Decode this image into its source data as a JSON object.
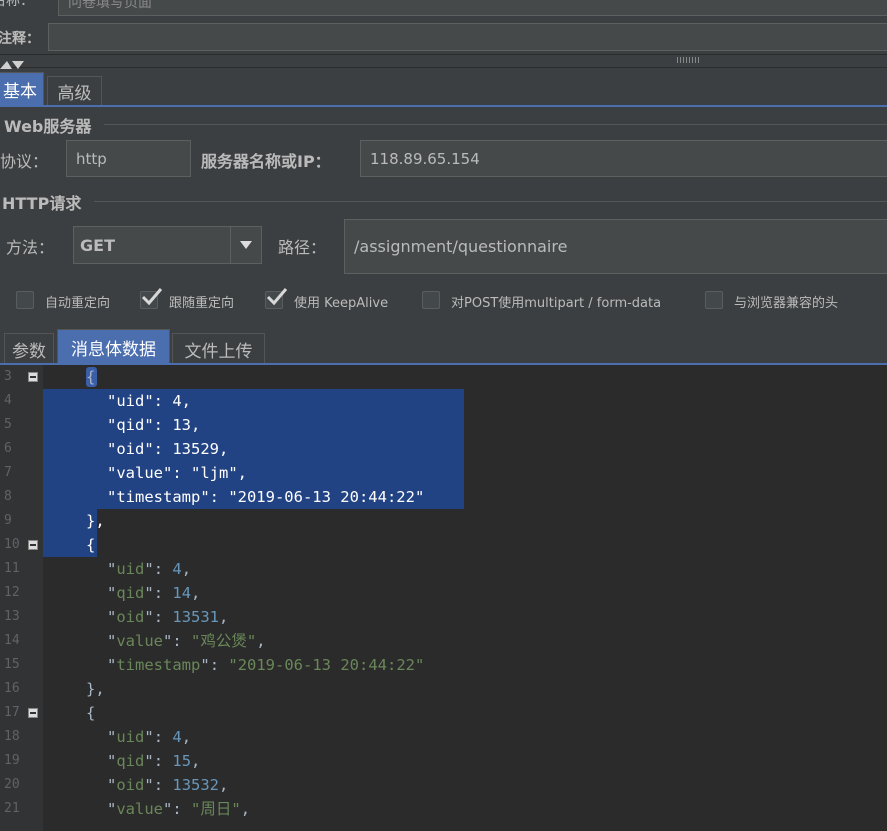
{
  "top": {
    "name_label": "名称：",
    "name_value": "问卷填写页面",
    "comment_label": "注释："
  },
  "config_tabs": [
    "基本",
    "高级"
  ],
  "web_server": {
    "section_title": "Web服务器",
    "protocol_label": "协议：",
    "protocol_value": "http",
    "server_label": "服务器名称或IP：",
    "server_value": "118.89.65.154"
  },
  "http_request": {
    "section_title": "HTTP请求",
    "method_label": "方法：",
    "method_value": "GET",
    "path_label": "路径：",
    "path_value": "/assignment/questionnaire"
  },
  "options": [
    {
      "label": "自动重定向",
      "checked": false
    },
    {
      "label": "跟随重定向",
      "checked": true
    },
    {
      "label": "使用 KeepAlive",
      "checked": true
    },
    {
      "label": "对POST使用multipart / form-data",
      "checked": false
    },
    {
      "label": "与浏览器兼容的头",
      "checked": false
    }
  ],
  "body_tabs": [
    "参数",
    "消息体数据",
    "文件上传"
  ],
  "editor": {
    "lines": [
      {
        "n": "3",
        "fold": true,
        "text": "{"
      },
      {
        "n": "4",
        "text": "\"uid\": 4,"
      },
      {
        "n": "5",
        "text": "\"qid\": 13,"
      },
      {
        "n": "6",
        "text": "\"oid\": 13529,"
      },
      {
        "n": "7",
        "text": "\"value\": \"ljm\","
      },
      {
        "n": "8",
        "text": "\"timestamp\": \"2019-06-13 20:44:22\""
      },
      {
        "n": "9",
        "text": "},"
      },
      {
        "n": "10",
        "fold": true,
        "text": "{"
      },
      {
        "n": "11",
        "text": "\"uid\": 4,"
      },
      {
        "n": "12",
        "text": "\"qid\": 14,"
      },
      {
        "n": "13",
        "text": "\"oid\": 13531,"
      },
      {
        "n": "14",
        "text": "\"value\": \"鸡公煲\","
      },
      {
        "n": "15",
        "text": "\"timestamp\": \"2019-06-13 20:44:22\""
      },
      {
        "n": "16",
        "text": "},"
      },
      {
        "n": "17",
        "fold": true,
        "text": "{"
      },
      {
        "n": "18",
        "text": "\"uid\": 4,"
      },
      {
        "n": "19",
        "text": "\"qid\": 15,"
      },
      {
        "n": "20",
        "text": "\"oid\": 13532,"
      },
      {
        "n": "21",
        "text": "\"value\": \"周日\","
      }
    ]
  }
}
